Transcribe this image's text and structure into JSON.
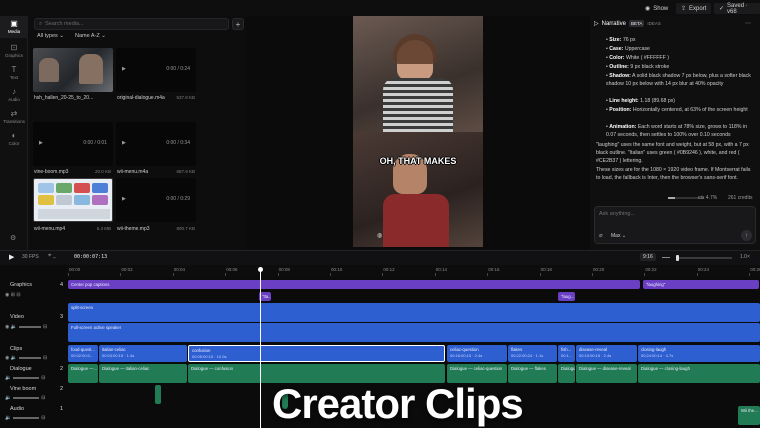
{
  "topbar": {
    "show": "Show",
    "export": "Export",
    "saved": "Saved · v68"
  },
  "rail": [
    {
      "label": "Media",
      "icon": "media-icon"
    },
    {
      "label": "Graphics",
      "icon": "graphics-icon"
    },
    {
      "label": "Text",
      "icon": "text-icon"
    },
    {
      "label": "Audio",
      "icon": "audio-icon"
    },
    {
      "label": "Transitions",
      "icon": "transitions-icon"
    },
    {
      "label": "Color",
      "icon": "color-icon"
    }
  ],
  "media": {
    "search_placeholder": "Search media...",
    "filter_type": "All types",
    "filter_sort": "Name A-Z",
    "items": [
      {
        "name": "hsh_hallen_20-25_to_20...",
        "meta": "",
        "kind": "video"
      },
      {
        "name": "original-dialogue.m4a",
        "meta": "537.8 KB",
        "kind": "audio",
        "time": "0:00 / 0:24"
      },
      {
        "name": "vine-boom.mp3",
        "meta": "20.0 KB",
        "kind": "audio",
        "time": "0:00 / 0:01"
      },
      {
        "name": "wii-menu.m4a",
        "meta": "687.9 KB",
        "kind": "audio",
        "time": "0:00 / 0:34"
      },
      {
        "name": "wii-menu.mp4",
        "meta": "6.3 MB",
        "kind": "video"
      },
      {
        "name": "wii-theme.mp3",
        "meta": "800.7 KB",
        "kind": "audio",
        "time": "0:00 / 0:29"
      }
    ]
  },
  "preview": {
    "caption": "OH, THAT MAKES"
  },
  "narrative": {
    "title": "Narrative",
    "badge_beta": "BETA",
    "badge_ideas": "IDEAS",
    "lines": [
      {
        "k": "Size:",
        "v": "76 px"
      },
      {
        "k": "Case:",
        "v": "Uppercase"
      },
      {
        "k": "Color:",
        "v": "White ( #FFFFFF )"
      },
      {
        "k": "Outline:",
        "v": "9 px black stroke"
      },
      {
        "k": "Shadow:",
        "v": "A solid black shadow 7 px below, plus a softer black shadow 10 px below with 14 px blur at 40% opacity"
      },
      {
        "k": "Line height:",
        "v": "1.18 (89.68 px)"
      },
      {
        "k": "Position:",
        "v": "Horizontally centered, at 63% of the screen height"
      },
      {
        "k": "Animation:",
        "v": "Each word starts at 78% size, grows to 118% in 0.07 seconds, then settles to 100% over 0.10 seconds"
      }
    ],
    "para1": "\"laughing\" uses the same font and weight, but at 58 px, with a 7 px black outline. \"Italian\" uses green ( #0B9246 ), white, and red ( #CE2B37 ) lettering.",
    "para2": "These sizes are for the 1080 × 1920 video frame. If Montserrat fails to load, the fallback is Inter, then the browser's sans-serif font.",
    "ctx": "ctx 4.7%",
    "credits": "261 credits",
    "ask_placeholder": "Ask anything...",
    "model": "Max"
  },
  "timeline": {
    "fps": "30 FPS",
    "timecode": "00:00:07:13",
    "aspect": "9:16",
    "zoom": "1.0×",
    "ticks": [
      "00:00",
      "00:02",
      "00:04",
      "00:06",
      "00:08",
      "00:10",
      "00:12",
      "00:14",
      "00:16",
      "00:18",
      "00:20",
      "00:22",
      "00:24",
      "00:26"
    ],
    "tracks": [
      {
        "name": "Graphics",
        "num": "4"
      },
      {
        "name": "Video",
        "num": "3"
      },
      {
        "name": "Clips",
        "num": ""
      },
      {
        "name": "Dialogue",
        "num": "2"
      },
      {
        "name": "Vine boom",
        "num": "2"
      },
      {
        "name": "Audio",
        "num": "1"
      }
    ],
    "graphics": {
      "main": "Center pop captions",
      "end": "\"laughing\"",
      "small1": "\"Ita...",
      "small2": "\"laug..."
    },
    "video": {
      "a": "split-screen",
      "b": "Full-screen active speaker"
    },
    "clips": [
      {
        "name": "food-quest...",
        "time": "00:02:00:0..."
      },
      {
        "name": "italian-celiac",
        "time": "00:03:00:15 · 1.4s"
      },
      {
        "name": "confusion",
        "time": "00:05:00:15 · 10.0s"
      },
      {
        "name": "celiac-question",
        "time": "00:16:00:15 · 2.4s"
      },
      {
        "name": "flakes",
        "time": "00:22:00:24 · 1.1s"
      },
      {
        "name": "fish...",
        "time": "00:1..."
      },
      {
        "name": "disease-reveal",
        "time": "00:19:00:15 · 2.4s"
      },
      {
        "name": "closing-laugh",
        "time": "00:24:00:14 · 4.7s"
      }
    ],
    "dialogue": [
      "Dialogue —...",
      "Dialogue — italian-celiac",
      "Dialogue — confusion",
      "Dialogue — celiac-question",
      "Dialogue — flakes",
      "Dialogu...",
      "Dialogue — disease-reveal",
      "Dialogue — closing-laugh"
    ],
    "audio_end": "Wii the..."
  },
  "watermark": "Creator Clips"
}
